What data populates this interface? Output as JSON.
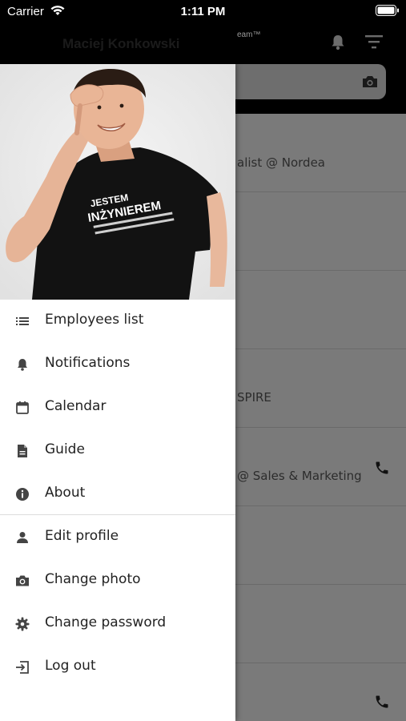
{
  "status_bar": {
    "carrier": "Carrier",
    "time": "1:11 PM"
  },
  "app_bar": {
    "title": "Maciej Konkowski",
    "subtitle": "eam™"
  },
  "list_rows": [
    {
      "text": "alist @ Nordea"
    },
    {
      "text": ""
    },
    {
      "text": ""
    },
    {
      "text": "SPIRE"
    },
    {
      "text": "@ Sales & Marketing"
    },
    {
      "text": ""
    },
    {
      "text": ""
    },
    {
      "text": ""
    }
  ],
  "menu": {
    "primary": [
      {
        "label": "Employees list",
        "icon": "list-icon"
      },
      {
        "label": "Notifications",
        "icon": "bell-icon"
      },
      {
        "label": "Calendar",
        "icon": "calendar-icon"
      },
      {
        "label": "Guide",
        "icon": "document-icon"
      },
      {
        "label": "About",
        "icon": "info-icon"
      }
    ],
    "secondary": [
      {
        "label": "Edit profile",
        "icon": "person-icon"
      },
      {
        "label": "Change photo",
        "icon": "camera-icon"
      },
      {
        "label": "Change password",
        "icon": "gear-icon"
      },
      {
        "label": "Log out",
        "icon": "logout-icon"
      }
    ]
  },
  "profile": {
    "shirt_line1": "JESTEM",
    "shirt_line2": "INŻYNIEREM"
  },
  "colors": {
    "background": "#000000",
    "overlay_list": "#7a7a7a",
    "drawer": "#ffffff",
    "text": "#222222"
  }
}
